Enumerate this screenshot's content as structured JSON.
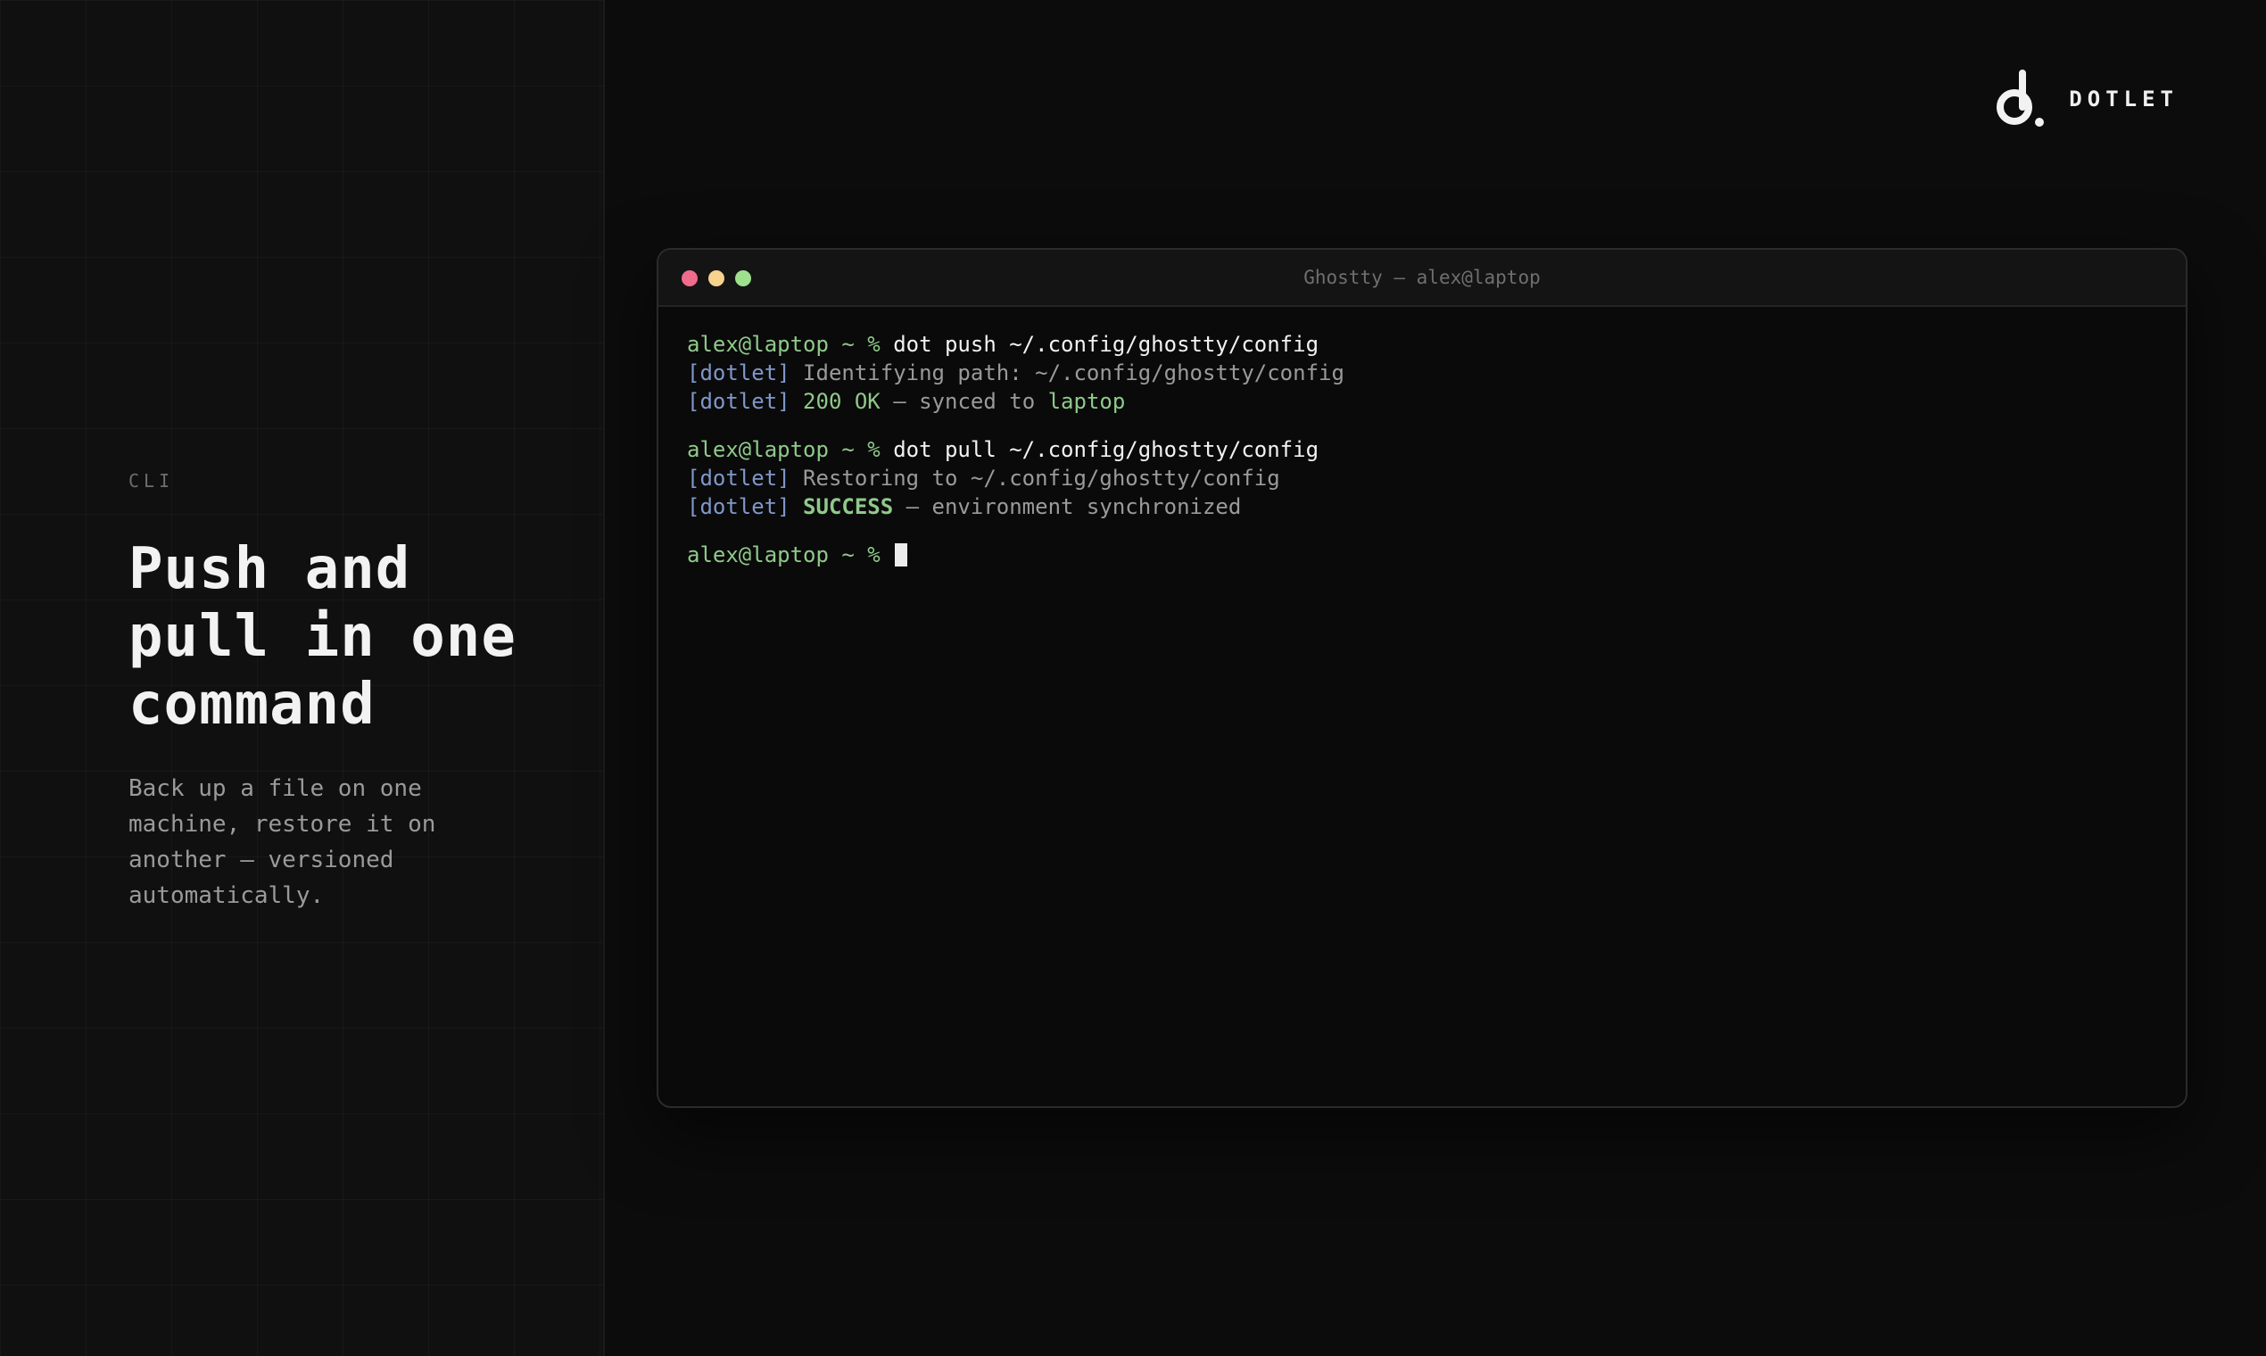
{
  "brand": {
    "name": "DOTLET",
    "logo_icon": "dotlet-logo-icon"
  },
  "hero": {
    "eyebrow": "CLI",
    "headline_lines": [
      "Push and",
      "pull in one",
      "command"
    ],
    "description": "Back up a file on one machine, restore it on another — versioned automatically."
  },
  "terminal": {
    "title": "Ghostty — alex@laptop",
    "window_controls": [
      "close",
      "minimize",
      "zoom"
    ],
    "colors": {
      "close": "#f06c8c",
      "minimize": "#f5d28e",
      "zoom": "#9ee08e",
      "prompt": "#8fc98a",
      "tag": "#7f97c9"
    },
    "blocks": [
      {
        "prompt": "alex@laptop ~ % ",
        "command": "dot push ~/.config/ghostty/config",
        "output": [
          {
            "tag": "[dotlet]",
            "highlight": "",
            "text": " Identifying path: ~/.config/ghostty/config",
            "host": ""
          },
          {
            "tag": "[dotlet]",
            "highlight": " 200 OK",
            "text": " — synced to ",
            "host": "laptop"
          }
        ]
      },
      {
        "prompt": "alex@laptop ~ % ",
        "command": "dot pull ~/.config/ghostty/config",
        "output": [
          {
            "tag": "[dotlet]",
            "highlight": "",
            "text": " Restoring to ~/.config/ghostty/config",
            "host": ""
          },
          {
            "tag": "[dotlet]",
            "highlight": " SUCCESS",
            "text": " — environment synchronized",
            "host": ""
          }
        ]
      }
    ],
    "final_prompt": "alex@laptop ~ % "
  }
}
